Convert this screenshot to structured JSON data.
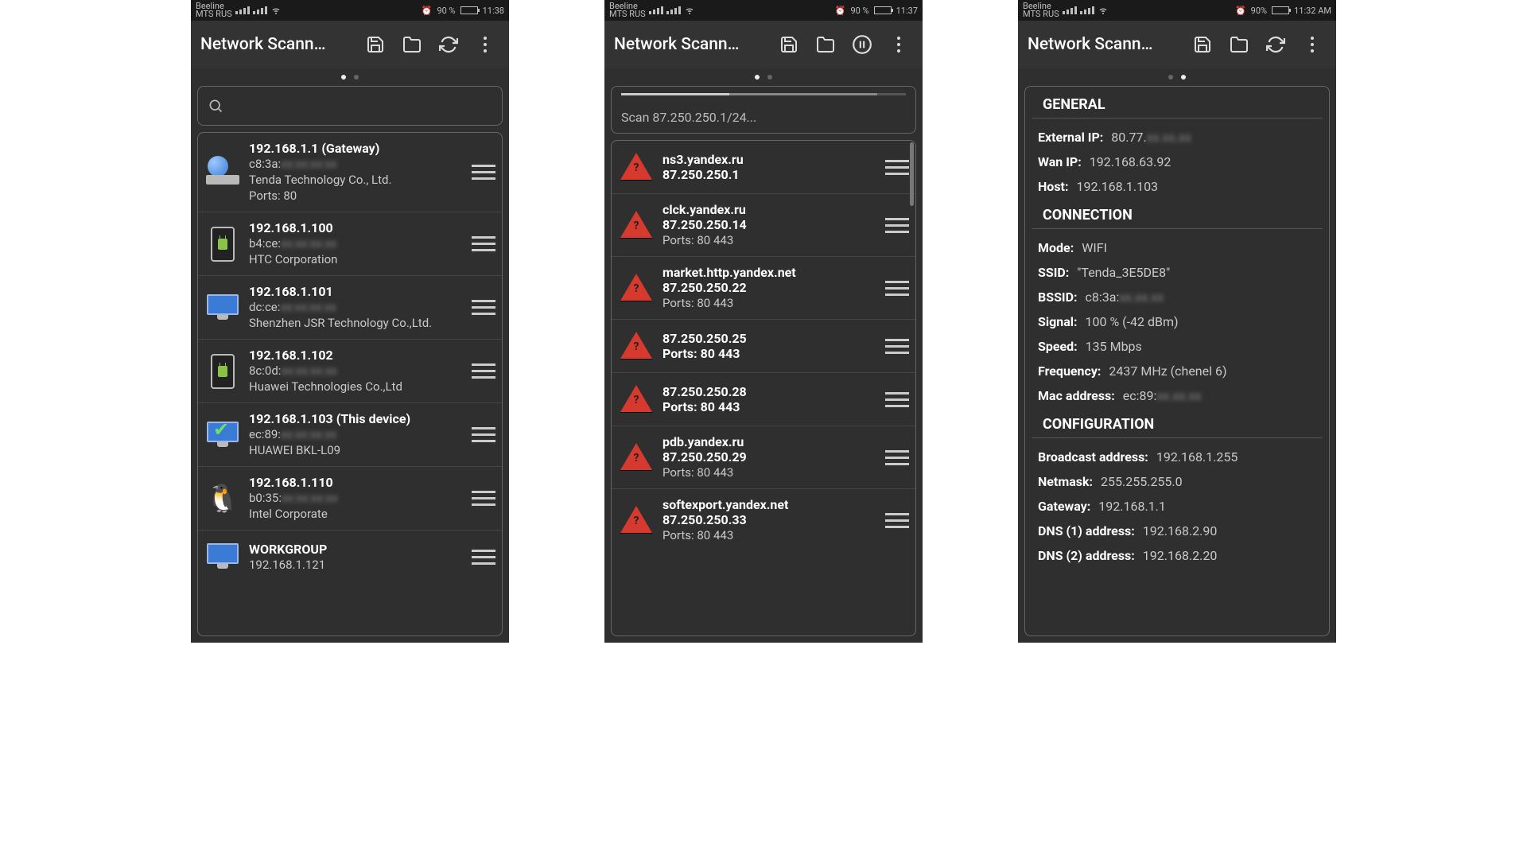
{
  "screens": [
    {
      "status": {
        "carrier1": "Beeline",
        "carrier2": "MTS RUS",
        "battery": "90 %",
        "time": "11:38",
        "alarm": true
      },
      "title": "Network Scann…",
      "toolbar": [
        "save",
        "folder",
        "refresh",
        "menu"
      ],
      "pager_active": 0,
      "search_placeholder": "",
      "devices": [
        {
          "icon": "router",
          "l1": "192.168.1.1 (Gateway)",
          "l2": "c8:3a:",
          "l2b": " ",
          "l3": "Tenda Technology Co., Ltd.",
          "l4": "Ports: 80"
        },
        {
          "icon": "android",
          "l1": "192.168.1.100",
          "l2": "b4:ce:",
          "l2b": " ",
          "l3": "HTC Corporation"
        },
        {
          "icon": "monitor",
          "l1": "192.168.1.101",
          "l2": "dc:ce:",
          "l2b": " ",
          "l3": "Shenzhen JSR Technology Co.,Ltd."
        },
        {
          "icon": "android",
          "l1": "192.168.1.102",
          "l2": "8c:0d:",
          "l2b": " ",
          "l3": "Huawei Technologies Co.,Ltd"
        },
        {
          "icon": "monitor-check",
          "l1": "192.168.1.103 (This device)",
          "l2": "ec:89:",
          "l2b": " ",
          "l3": "HUAWEI BKL-L09"
        },
        {
          "icon": "tux",
          "l1": "192.168.1.110",
          "l2": "b0:35:",
          "l2b": " ",
          "l3": "Intel Corporate"
        },
        {
          "icon": "monitor",
          "l1": "WORKGROUP",
          "l2": "192.168.1.121",
          "l3": ""
        }
      ]
    },
    {
      "status": {
        "carrier1": "Beeline",
        "carrier2": "MTS RUS",
        "battery": "90 %",
        "time": "11:37",
        "alarm": true
      },
      "title": "Network Scann…",
      "toolbar": [
        "save",
        "folder",
        "pause",
        "menu"
      ],
      "pager_active": 0,
      "scan_label": "Scan 87.250.250.1/24...",
      "hosts": [
        {
          "l1": "ns3.yandex.ru",
          "l2": "87.250.250.1"
        },
        {
          "l1": "clck.yandex.ru",
          "l2": "87.250.250.14",
          "l3": "Ports: 80 443"
        },
        {
          "l1": "market.http.yandex.net",
          "l2": "87.250.250.22",
          "l3": "Ports: 80 443"
        },
        {
          "l1": "87.250.250.25",
          "l2": "Ports: 80 443"
        },
        {
          "l1": "87.250.250.28",
          "l2": "Ports: 80 443"
        },
        {
          "l1": "pdb.yandex.ru",
          "l2": "87.250.250.29",
          "l3": "Ports: 80 443"
        },
        {
          "l1": "softexport.yandex.net",
          "l2": "87.250.250.33",
          "l3": "Ports: 80 443"
        }
      ]
    },
    {
      "status": {
        "carrier1": "Beeline",
        "carrier2": "MTS RUS",
        "battery": "90%",
        "time": "11:32 AM",
        "alarm": true
      },
      "title": "Network Scann…",
      "toolbar": [
        "save",
        "folder",
        "refresh",
        "menu"
      ],
      "pager_active": 1,
      "sections": [
        {
          "title": "GENERAL",
          "rows": [
            {
              "k": "External IP:",
              "v": "80.77.",
              "blur": true
            },
            {
              "k": "Wan IP:",
              "v": "192.168.63.92"
            },
            {
              "k": "Host:",
              "v": "192.168.1.103"
            }
          ]
        },
        {
          "title": "CONNECTION",
          "rows": [
            {
              "k": "Mode:",
              "v": "WIFI"
            },
            {
              "k": "SSID:",
              "v": "\"Tenda_3E5DE8\""
            },
            {
              "k": "BSSID:",
              "v": "c8:3a:",
              "blur": true
            },
            {
              "k": "Signal:",
              "v": "100 % (-42 dBm)"
            },
            {
              "k": "Speed:",
              "v": "135 Mbps"
            },
            {
              "k": "Frequency:",
              "v": "2437 MHz (chenel 6)"
            },
            {
              "k": "Mac address:",
              "v": "ec:89:",
              "blur": true
            }
          ]
        },
        {
          "title": "CONFIGURATION",
          "rows": [
            {
              "k": "Broadcast address:",
              "v": "192.168.1.255"
            },
            {
              "k": "Netmask:",
              "v": "255.255.255.0"
            },
            {
              "k": "Gateway:",
              "v": "192.168.1.1"
            },
            {
              "k": "DNS (1) address:",
              "v": "192.168.2.90"
            },
            {
              "k": "DNS (2) address:",
              "v": "192.168.2.20"
            }
          ]
        }
      ]
    }
  ],
  "icons": {
    "save": "save-icon",
    "folder": "folder-icon",
    "refresh": "refresh-icon",
    "pause": "pause-icon",
    "menu": "overflow-menu-icon"
  }
}
